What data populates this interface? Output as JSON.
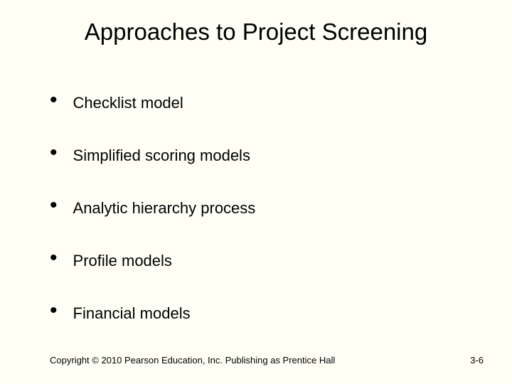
{
  "title": "Approaches to Project Screening",
  "bullets": [
    "Checklist model",
    "Simplified scoring models",
    "Analytic hierarchy process",
    "Profile models",
    "Financial models"
  ],
  "footer": {
    "copyright": "Copyright © 2010 Pearson Education, Inc. Publishing as Prentice Hall",
    "page": "3-6"
  }
}
